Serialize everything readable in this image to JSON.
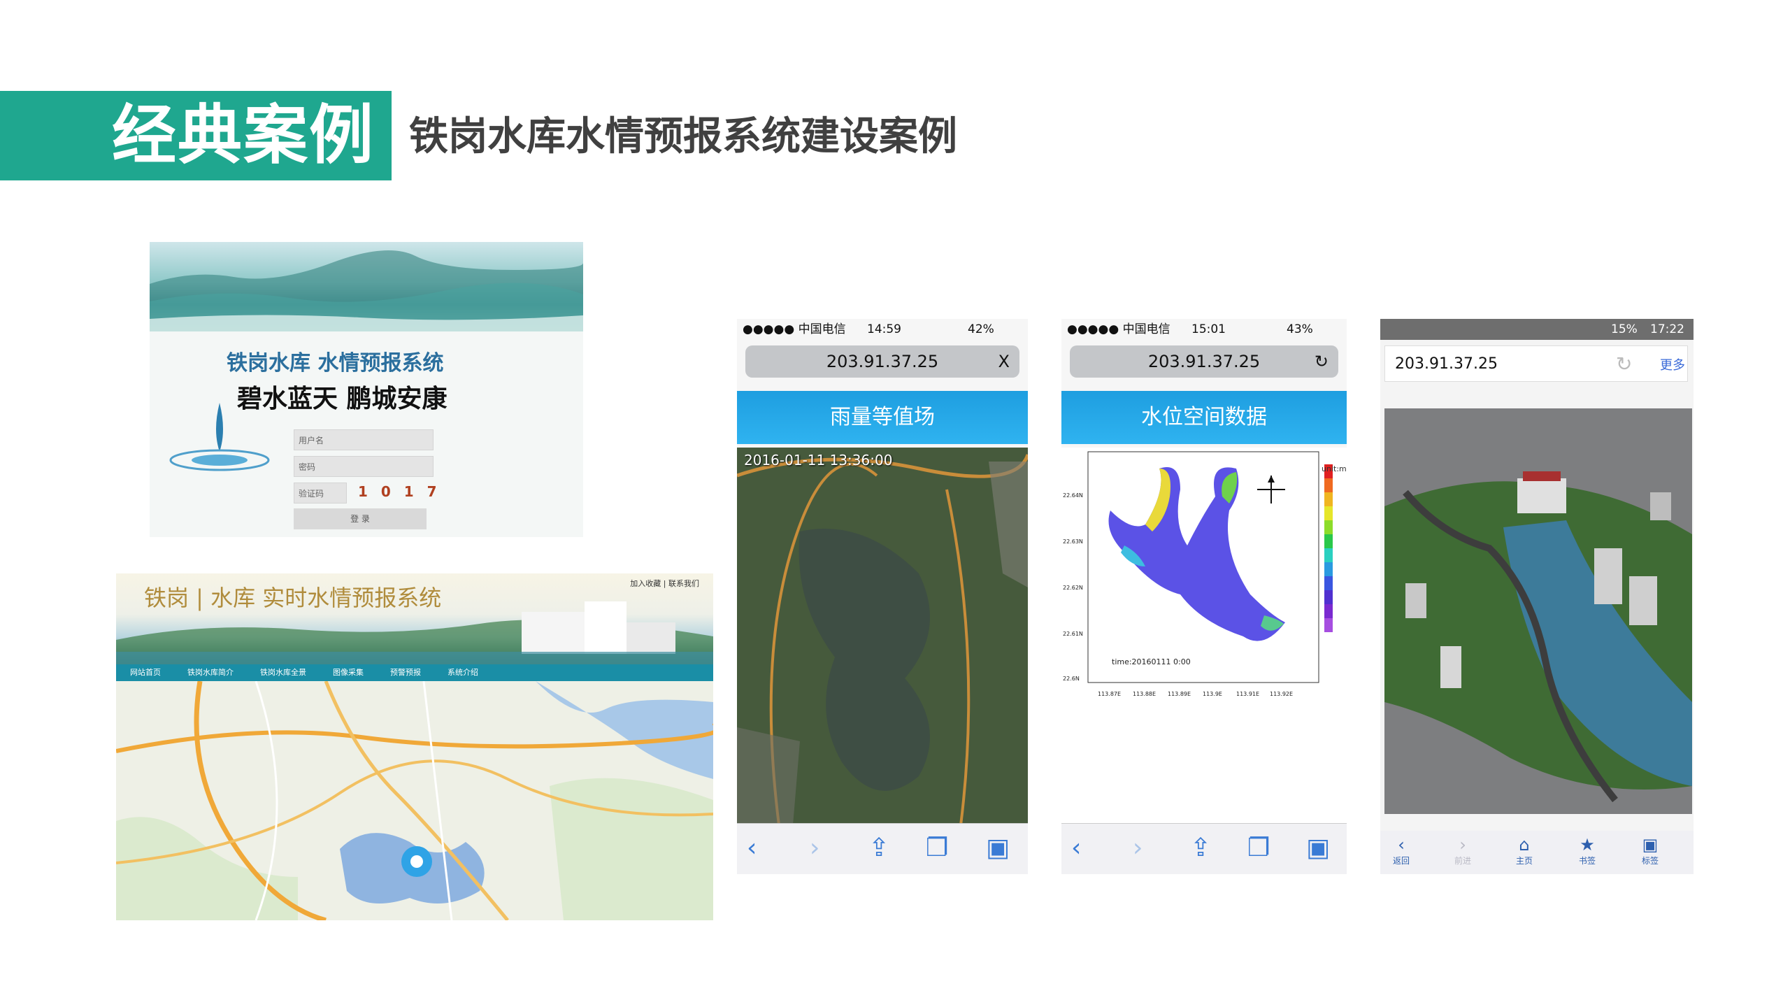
{
  "header": {
    "title": "经典案例",
    "subtitle": "铁岗水库水情预报系统建设案例",
    "accent_color": "#1fa78f"
  },
  "login_page": {
    "title": "铁岗水库 水情预报系统",
    "calligraphy": "碧水蓝天 鹏城安康",
    "username_placeholder": "用户名",
    "password_placeholder": "密码",
    "captcha_placeholder": "验证码",
    "captcha_code": "1 0 1 7",
    "login_button": "登 录"
  },
  "website": {
    "logo": "铁岗 | 水库 实时水情预报系统",
    "top_links": "加入收藏 | 联系我们",
    "nav": [
      "网站首页",
      "铁岗水库简介",
      "铁岗水库全景",
      "图像采集",
      "预警预报",
      "系统介绍"
    ]
  },
  "phone1": {
    "carrier": "●●●●● 中国电信",
    "time": "14:59",
    "battery": "42%",
    "url": "203.91.37.25",
    "url_action": "X",
    "page_title": "雨量等值场",
    "timestamp": "2016-01-11 13:36:00"
  },
  "phone2": {
    "carrier": "●●●●● 中国电信",
    "time": "15:01",
    "battery": "43%",
    "url": "203.91.37.25",
    "page_title": "水位空间数据",
    "legend_title": "unit:m",
    "time_label": "time:20160111 0:00",
    "y_labels": [
      "22.64N",
      "22.63N",
      "22.62N",
      "22.61N",
      "22.6N"
    ],
    "x_labels": [
      "113.87E",
      "113.88E",
      "113.89E",
      "113.9E",
      "113.91E",
      "113.92E"
    ]
  },
  "phone3": {
    "time": "17:22",
    "battery": "15%",
    "url": "203.91.37.25",
    "more": "更多",
    "toolbar": [
      "返回",
      "前进",
      "主页",
      "书签",
      "标签"
    ]
  }
}
